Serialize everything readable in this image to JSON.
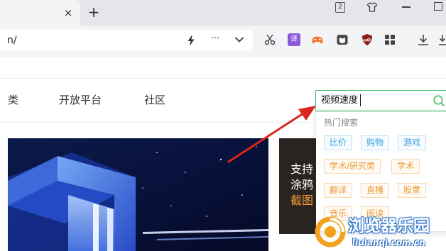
{
  "tabs": {
    "close_glyph": "×",
    "new_tab_glyph": "+",
    "tab_count": "2"
  },
  "addressbar": {
    "url": "n/",
    "more_glyph": "···"
  },
  "toolbar": {
    "translate_label": "译"
  },
  "site_nav": {
    "items": [
      "类",
      "开放平台",
      "社区"
    ]
  },
  "search": {
    "value": "视频速度"
  },
  "hot_search": {
    "heading": "热门搜索",
    "blue_tags": [
      "比价",
      "购物",
      "游戏"
    ],
    "orange_tags": [
      "学术/研究类",
      "学术",
      "翻译",
      "直播",
      "股票",
      "音乐",
      "阅读"
    ]
  },
  "side_card": {
    "lines": [
      "支持",
      "涂鸦",
      "截图"
    ]
  },
  "watermark": {
    "title": "浏览器乐园",
    "url": "liulanqi.com.cn"
  },
  "colors": {
    "accent_green": "#3cbf6a",
    "arrow_red": "#d9261c",
    "tag_blue": "#3c9fe0",
    "tag_orange": "#ec9a3b"
  }
}
